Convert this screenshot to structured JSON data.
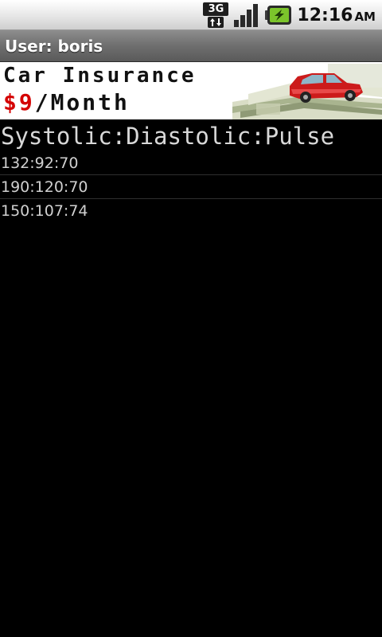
{
  "status_bar": {
    "network_label": "3G",
    "time": "12:16",
    "ampm": "AM",
    "icons": [
      "3g-data-icon",
      "signal-icon",
      "battery-charging-icon"
    ]
  },
  "title_bar": {
    "title": "User: boris"
  },
  "ad": {
    "line1": "Car Insurance",
    "price": "$9",
    "line2_rest": "/Month",
    "price_color": "#d40000"
  },
  "readings": {
    "header": "Systolic:Diastolic:Pulse",
    "items": [
      {
        "value": "132:92:70"
      },
      {
        "value": "190:120:70"
      },
      {
        "value": "150:107:74"
      }
    ]
  }
}
